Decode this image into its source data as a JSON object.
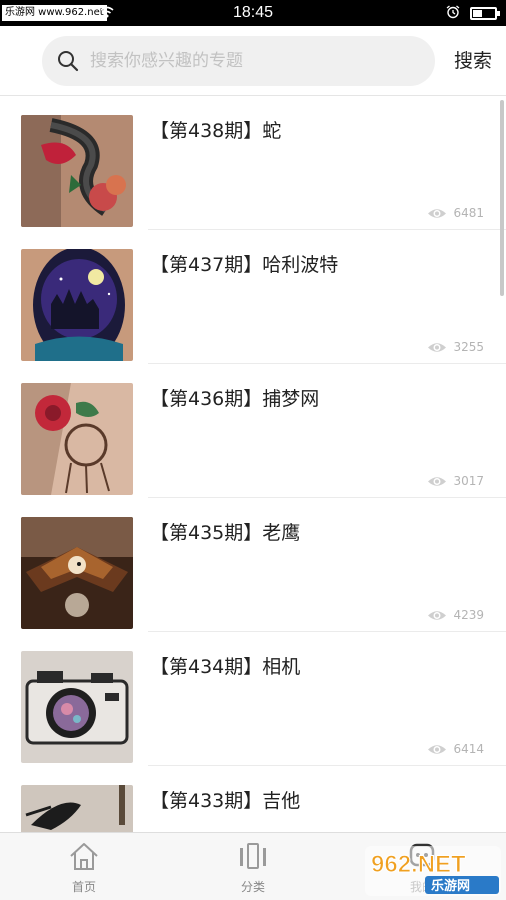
{
  "status_bar": {
    "watermark": "乐游网 www.962.net",
    "time": "18:45",
    "battery_level": 0.4
  },
  "search": {
    "placeholder": "搜索你感兴趣的专题",
    "button_label": "搜索"
  },
  "topics": [
    {
      "title": "【第438期】蛇",
      "views": "6481"
    },
    {
      "title": "【第437期】哈利波特",
      "views": "3255"
    },
    {
      "title": "【第436期】捕梦网",
      "views": "3017"
    },
    {
      "title": "【第435期】老鹰",
      "views": "4239"
    },
    {
      "title": "【第434期】相机",
      "views": "6414"
    },
    {
      "title": "【第433期】吉他",
      "views": ""
    }
  ],
  "tab_bar": {
    "home_label": "首页",
    "category_label": "分类",
    "profile_label": "我的"
  },
  "watermark_bottom": {
    "domain": "962.NET",
    "brand": "乐游网"
  }
}
